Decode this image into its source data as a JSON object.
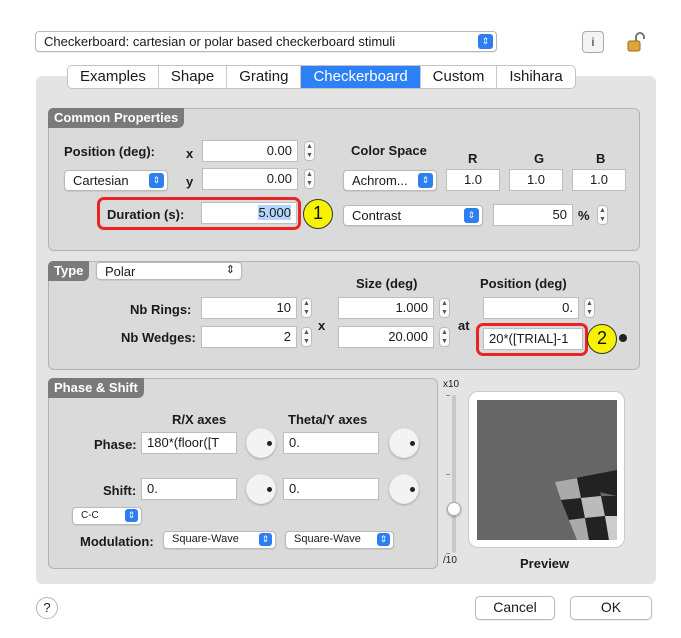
{
  "top": {
    "stimulus_select": "Checkerboard: cartesian or polar based checkerboard stimuli",
    "info_button": "i"
  },
  "tabs": [
    "Examples",
    "Shape",
    "Grating",
    "Checkerboard",
    "Custom",
    "Ishihara"
  ],
  "active_tab": "Checkerboard",
  "common": {
    "title": "Common Properties",
    "position_label": "Position (deg):",
    "x_label": "x",
    "y_label": "y",
    "x_value": "0.00",
    "y_value": "0.00",
    "coord_select": "Cartesian",
    "duration_label": "Duration (s):",
    "duration_value": "5.000",
    "color_space_label": "Color Space",
    "color_space_select": "Achrom...",
    "r_label": "R",
    "g_label": "G",
    "b_label": "B",
    "r_value": "1.0",
    "g_value": "1.0",
    "b_value": "1.0",
    "contrast_select": "Contrast",
    "contrast_value": "50",
    "percent": "%"
  },
  "type_group": {
    "title": "Type",
    "type_select": "Polar",
    "size_label": "Size (deg)",
    "position_label": "Position (deg)",
    "rings_label": "Nb Rings:",
    "rings_value": "10",
    "wedges_label": "Nb Wedges:",
    "wedges_value": "2",
    "x_sep": "x",
    "size1_value": "1.000",
    "size2_value": "20.000",
    "at_label": "at",
    "pos1_value": "0.",
    "pos2_value": "20*([TRIAL]-1"
  },
  "phase": {
    "title": "Phase & Shift",
    "rx_label": "R/X axes",
    "ty_label": "Theta/Y axes",
    "phase_label": "Phase:",
    "phase_rx": "180*(floor([T",
    "phase_ty": "0.",
    "shift_label": "Shift:",
    "shift_rx": "0.",
    "shift_ty": "0.",
    "cc_select": "C-C",
    "modulation_label": "Modulation:",
    "mod_rx": "Square-Wave",
    "mod_ty": "Square-Wave"
  },
  "slider": {
    "top_label": "x10",
    "bottom_label": "/10"
  },
  "preview_label": "Preview",
  "annotations": {
    "badge1": "1",
    "badge2": "2"
  },
  "buttons": {
    "help": "?",
    "cancel": "Cancel",
    "ok": "OK"
  },
  "colors": {
    "accent": "#2d81f7",
    "highlight_red": "#ea2424",
    "badge_yellow": "#f6f200",
    "group_title": "#7a7a7a"
  }
}
